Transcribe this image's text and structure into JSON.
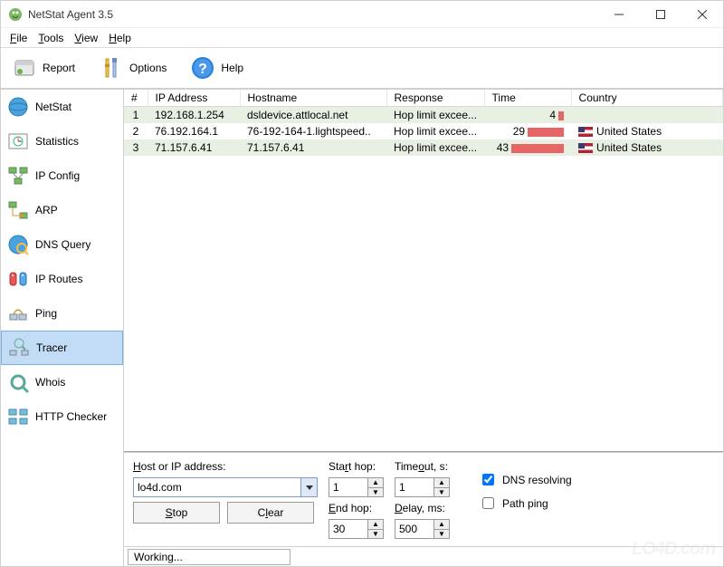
{
  "window": {
    "title": "NetStat Agent 3.5"
  },
  "menu": {
    "file": "File",
    "tools": "Tools",
    "view": "View",
    "help": "Help"
  },
  "toolbar": {
    "report": "Report",
    "options": "Options",
    "help": "Help"
  },
  "sidebar": {
    "items": [
      {
        "label": "NetStat",
        "id": "netstat"
      },
      {
        "label": "Statistics",
        "id": "statistics"
      },
      {
        "label": "IP Config",
        "id": "ipconfig"
      },
      {
        "label": "ARP",
        "id": "arp"
      },
      {
        "label": "DNS Query",
        "id": "dnsquery"
      },
      {
        "label": "IP Routes",
        "id": "iproutes"
      },
      {
        "label": "Ping",
        "id": "ping"
      },
      {
        "label": "Tracer",
        "id": "tracer"
      },
      {
        "label": "Whois",
        "id": "whois"
      },
      {
        "label": "HTTP Checker",
        "id": "httpchecker"
      }
    ],
    "selected": "tracer"
  },
  "table": {
    "columns": [
      "#",
      "IP Address",
      "Hostname",
      "Response",
      "Time",
      "Country"
    ],
    "rows": [
      {
        "n": "1",
        "ip": "192.168.1.254",
        "host": "dsldevice.attlocal.net",
        "resp": "Hop limit excee...",
        "time": "4",
        "time_bar": 6,
        "country": "",
        "flag": false
      },
      {
        "n": "2",
        "ip": "76.192.164.1",
        "host": "76-192-164-1.lightspeed..",
        "resp": "Hop limit excee...",
        "time": "29",
        "time_bar": 40,
        "country": "United States",
        "flag": true
      },
      {
        "n": "3",
        "ip": "71.157.6.41",
        "host": "71.157.6.41",
        "resp": "Hop limit excee...",
        "time": "43",
        "time_bar": 58,
        "country": "United States",
        "flag": true
      }
    ]
  },
  "controls": {
    "host_label": "Host or IP address:",
    "host_value": "lo4d.com",
    "stop": "Stop",
    "clear": "Clear",
    "start_hop_label": "Start hop:",
    "start_hop_value": "1",
    "end_hop_label": "End hop:",
    "end_hop_value": "30",
    "timeout_label": "Timeout, s:",
    "timeout_value": "1",
    "delay_label": "Delay, ms:",
    "delay_value": "500",
    "dns_resolving": "DNS resolving",
    "dns_resolving_checked": true,
    "path_ping": "Path ping",
    "path_ping_checked": false
  },
  "status": {
    "text": "Working..."
  },
  "watermark": "LO4D.com"
}
